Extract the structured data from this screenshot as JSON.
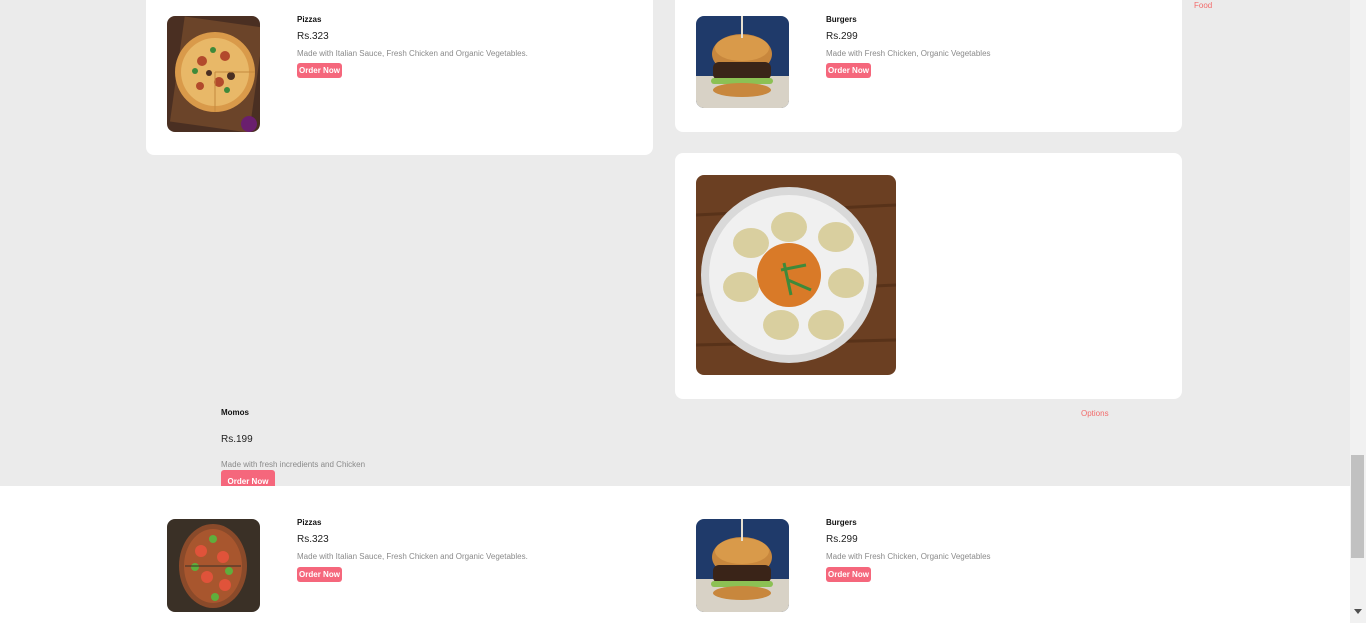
{
  "side_link": "Food",
  "options_link": "Options",
  "top_cards": [
    {
      "name": "Pizzas",
      "price": "Rs.323",
      "desc": "Made with Italian Sauce, Fresh Chicken and Organic Vegetables.",
      "button": "Order Now",
      "image_icon": "pizza-image"
    },
    {
      "name": "Burgers",
      "price": "Rs.299",
      "desc": "Made with Fresh Chicken, Organic Vegetables",
      "button": "Order Now",
      "image_icon": "burger-image"
    }
  ],
  "featured": {
    "name": "Momos",
    "price": "Rs.199",
    "desc": "Made with fresh incredients and Chicken",
    "button": "Order Now",
    "image_icon": "momos-image"
  },
  "bottom_cards": [
    {
      "name": "Pizzas",
      "price": "Rs.323",
      "desc": "Made with Italian Sauce, Fresh Chicken and Organic Vegetables.",
      "button": "Order Now",
      "image_icon": "pizza-image"
    },
    {
      "name": "Burgers",
      "price": "Rs.299",
      "desc": "Made with Fresh Chicken, Organic Vegetables",
      "button": "Order Now",
      "image_icon": "burger-image"
    }
  ],
  "colors": {
    "accent": "#f5677c",
    "link": "#f26b6b",
    "page_bg": "#ebebeb",
    "card_bg": "#ffffff"
  }
}
